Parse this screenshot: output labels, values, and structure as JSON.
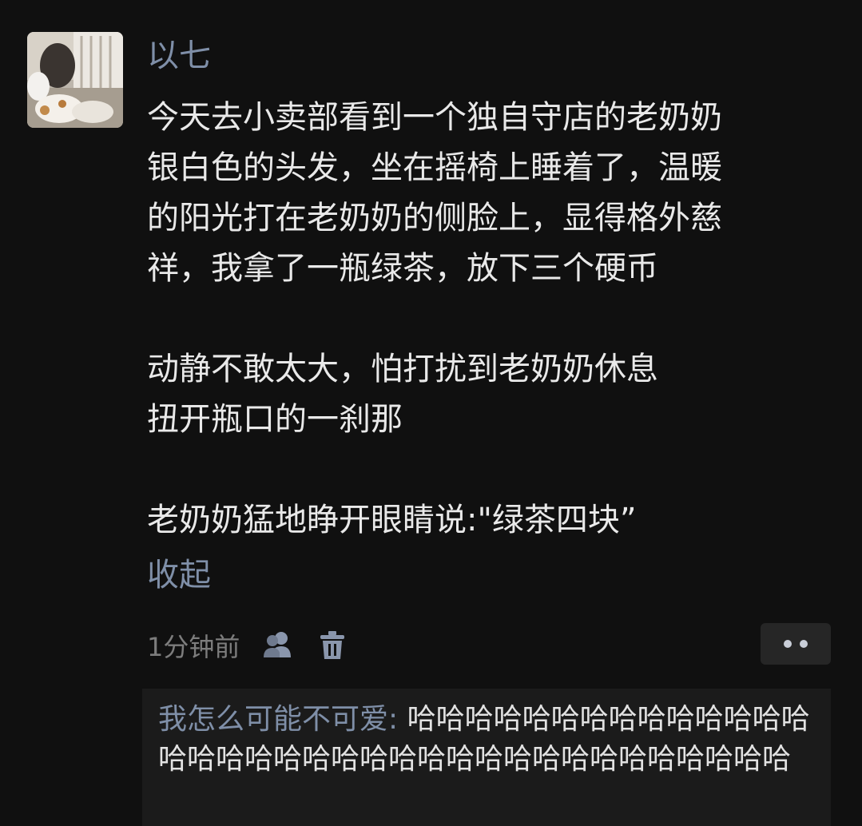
{
  "post": {
    "author": "以七",
    "paragraph1": "今天去小卖部看到一个独自守店的老奶奶\n银白色的头发，坐在摇椅上睡着了，温暖\n的阳光打在老奶奶的侧脸上，显得格外慈\n祥，我拿了一瓶绿茶，放下三个硬币",
    "paragraph2": "动静不敢太大，怕打扰到老奶奶休息\n扭开瓶口的一刹那",
    "paragraph3": "老奶奶猛地睁开眼睛说:\"绿茶四块”",
    "collapse_label": "收起",
    "timestamp": "1分钟前"
  },
  "icons": {
    "visibility": "people-icon",
    "delete": "trash-icon",
    "more": "more-dots-icon"
  },
  "comment": {
    "author": "我怎么可能不可爱",
    "separator": ": ",
    "text": "哈哈哈哈哈哈哈哈哈哈哈哈哈哈哈哈哈哈哈哈哈哈哈哈哈哈哈哈哈哈哈哈哈哈哈哈"
  },
  "colors": {
    "background": "#101010",
    "link": "#7f8fa8",
    "text": "#e9e9e9",
    "muted": "#7d7d7d",
    "comment_bg": "#1b1b1b"
  }
}
